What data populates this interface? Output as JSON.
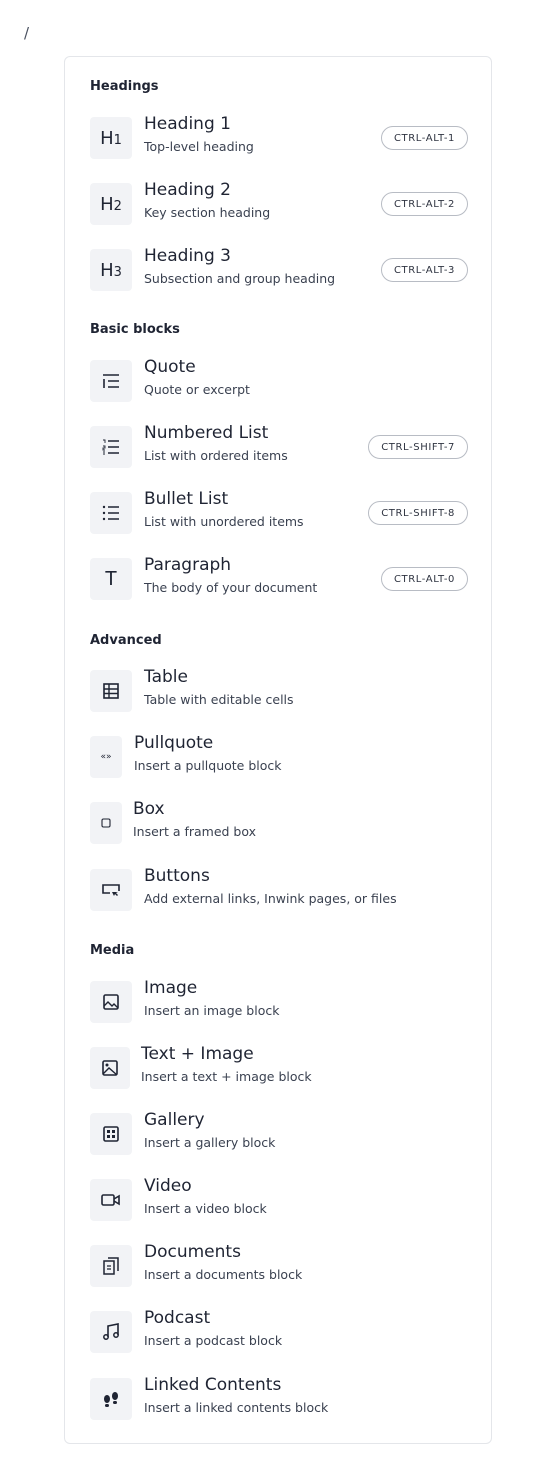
{
  "trigger": "/",
  "sections": [
    {
      "title": "Headings",
      "items": [
        {
          "title": "Heading 1",
          "desc": "Top-level heading",
          "shortcut": "CTRL-ALT-1",
          "icon": "heading-1-icon",
          "glyph": "H",
          "sub": "1"
        },
        {
          "title": "Heading 2",
          "desc": "Key section heading",
          "shortcut": "CTRL-ALT-2",
          "icon": "heading-2-icon",
          "glyph": "H",
          "sub": "2"
        },
        {
          "title": "Heading 3",
          "desc": "Subsection and group heading",
          "shortcut": "CTRL-ALT-3",
          "icon": "heading-3-icon",
          "glyph": "H",
          "sub": "3"
        }
      ]
    },
    {
      "title": "Basic blocks",
      "items": [
        {
          "title": "Quote",
          "desc": "Quote or excerpt",
          "shortcut": "",
          "icon": "quote-icon"
        },
        {
          "title": "Numbered List",
          "desc": "List with ordered items",
          "shortcut": "CTRL-SHIFT-7",
          "icon": "numbered-list-icon"
        },
        {
          "title": "Bullet List",
          "desc": "List with unordered items",
          "shortcut": "CTRL-SHIFT-8",
          "icon": "bullet-list-icon"
        },
        {
          "title": "Paragraph",
          "desc": "The body of your document",
          "shortcut": "CTRL-ALT-0",
          "icon": "paragraph-icon",
          "glyph": "T"
        }
      ]
    },
    {
      "title": "Advanced",
      "items": [
        {
          "title": "Table",
          "desc": "Table with editable cells",
          "shortcut": "",
          "icon": "table-icon"
        },
        {
          "title": "Pullquote",
          "desc": "Insert a pullquote block",
          "shortcut": "",
          "icon": "pullquote-icon",
          "glyph": "«»"
        },
        {
          "title": "Box",
          "desc": "Insert a framed box",
          "shortcut": "",
          "icon": "box-icon"
        },
        {
          "title": "Buttons",
          "desc": "Add external links, Inwink pages, or files",
          "shortcut": "",
          "icon": "buttons-icon"
        }
      ]
    },
    {
      "title": "Media",
      "items": [
        {
          "title": "Image",
          "desc": "Insert an image block",
          "shortcut": "",
          "icon": "image-icon"
        },
        {
          "title": "Text + Image",
          "desc": "Insert a text + image block",
          "shortcut": "",
          "icon": "text-image-icon"
        },
        {
          "title": "Gallery",
          "desc": "Insert a gallery block",
          "shortcut": "",
          "icon": "gallery-icon"
        },
        {
          "title": "Video",
          "desc": "Insert a video block",
          "shortcut": "",
          "icon": "video-icon"
        },
        {
          "title": "Documents",
          "desc": "Insert a documents block",
          "shortcut": "",
          "icon": "documents-icon"
        },
        {
          "title": "Podcast",
          "desc": "Insert a podcast block",
          "shortcut": "",
          "icon": "podcast-icon"
        },
        {
          "title": "Linked Contents",
          "desc": "Insert a linked contents block",
          "shortcut": "",
          "icon": "footprints-icon"
        }
      ]
    }
  ]
}
